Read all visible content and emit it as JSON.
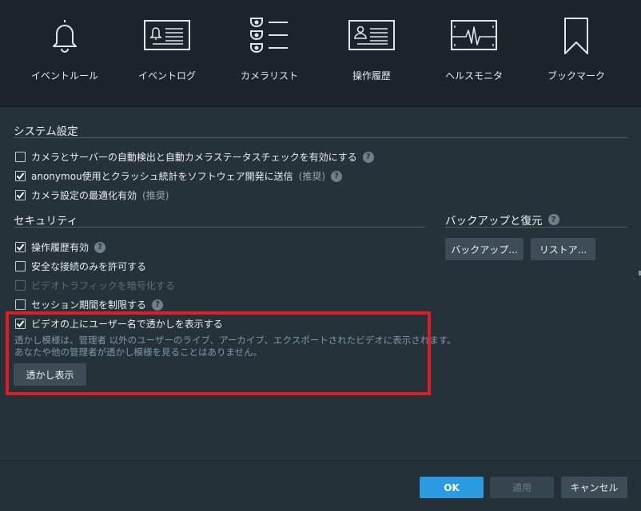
{
  "toolbar": {
    "items": [
      {
        "label": "イベントルール",
        "icon": "bell-icon"
      },
      {
        "label": "イベントログ",
        "icon": "event-log-icon"
      },
      {
        "label": "カメラリスト",
        "icon": "camera-list-icon"
      },
      {
        "label": "操作履歴",
        "icon": "audit-trail-icon"
      },
      {
        "label": "ヘルスモニタ",
        "icon": "health-monitor-icon"
      },
      {
        "label": "ブックマーク",
        "icon": "bookmark-icon"
      }
    ]
  },
  "system_settings": {
    "title": "システム設定",
    "options": [
      {
        "label": "カメラとサーバーの自動検出と自動カメラステータスチェックを有効にする",
        "checked": false,
        "recommended": "",
        "help": true
      },
      {
        "label": "anonymou使用とクラッシュ統計をソフトウェア開発に送信",
        "checked": true,
        "recommended": "(推奨)",
        "help": true
      },
      {
        "label": "カメラ設定の最適化有効",
        "checked": true,
        "recommended": "(推奨)",
        "help": false
      }
    ]
  },
  "security": {
    "title": "セキュリティ",
    "options": [
      {
        "label": "操作履歴有効",
        "checked": true,
        "disabled": false,
        "help": true
      },
      {
        "label": "安全な接続のみを許可する",
        "checked": false,
        "disabled": false,
        "help": false
      },
      {
        "label": "ビデオトラフィックを暗号化する",
        "checked": false,
        "disabled": true,
        "help": false
      },
      {
        "label": "セッション期間を制限する",
        "checked": false,
        "disabled": false,
        "help": true
      },
      {
        "label": "ビデオの上にユーザー名で透かしを表示する",
        "checked": true,
        "disabled": false,
        "help": false
      }
    ],
    "watermark_description_line1": "透かし模様は、管理者 以外のユーザーのライブ、アーカイブ、エクスポートされたビデオに表示されます。",
    "watermark_description_line2": "あなたや他の管理者が透かし模様を見ることはありません。",
    "watermark_button": "透かし表示"
  },
  "backup": {
    "title": "バックアップと復元",
    "backup_button": "バックアップ...",
    "restore_button": "リストア..."
  },
  "footer": {
    "ok_label": "OK",
    "apply_label": "適用",
    "cancel_label": "キャンセル"
  },
  "colors": {
    "accent": "#2a9be0",
    "highlight": "#e01b22",
    "background": "#263239"
  }
}
